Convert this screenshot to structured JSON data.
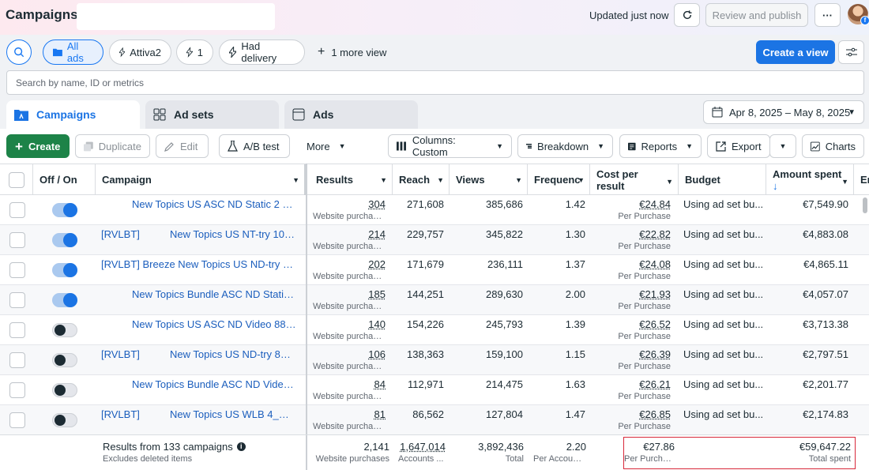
{
  "header": {
    "title": "Campaigns",
    "updated": "Updated just now",
    "review_publish": "Review and publish",
    "more": "···"
  },
  "views": {
    "all_ads": "All ads",
    "attiva2": "Attiva2",
    "one": "1",
    "had_delivery": "Had delivery",
    "more_view": "1 more view",
    "create_view": "Create a view"
  },
  "search": {
    "placeholder": "Search by name, ID or metrics"
  },
  "tabs": {
    "campaigns": "Campaigns",
    "ad_sets": "Ad sets",
    "ads": "Ads"
  },
  "date_range": "Apr 8, 2025 – May 8, 2025",
  "toolbar": {
    "create": "Create",
    "duplicate": "Duplicate",
    "edit": "Edit",
    "ab_test": "A/B test",
    "more": "More",
    "columns": "Columns: Custom",
    "breakdown": "Breakdown",
    "reports": "Reports",
    "export": "Export",
    "charts": "Charts"
  },
  "columns": {
    "off_on": "Off / On",
    "campaign": "Campaign",
    "results": "Results",
    "reach": "Reach",
    "views": "Views",
    "frequency": "Frequenc",
    "cost_per_result_1": "Cost per",
    "cost_per_result_2": "result",
    "budget": "Budget",
    "amount_spent": "Amount spent",
    "amount_spent_sort": "↓",
    "ends": "En"
  },
  "rows": [
    {
      "prefix": "",
      "name": "New Topics US ASC ND Static 2 65 8...",
      "on": true,
      "results": "304",
      "results_label": "Website purchases",
      "reach": "271,608",
      "views": "385,686",
      "frequency": "1.42",
      "cpr": "€24.84",
      "cpr_label": "Per Purchase",
      "budget": "Using ad set bu...",
      "spent": "€7,549.90"
    },
    {
      "prefix": "[RVLBT]",
      "name": "New Topics US NT-try 101_...",
      "on": true,
      "results": "214",
      "results_label": "Website purchases",
      "reach": "229,757",
      "views": "345,822",
      "frequency": "1.30",
      "cpr": "€22.82",
      "cpr_label": "Per Purchase",
      "budget": "Using ad set bu...",
      "spent": "€4,883.08"
    },
    {
      "prefix": "",
      "name": "[RVLBT] Breeze New Topics US ND-try 2_NY...",
      "on": true,
      "results": "202",
      "results_label": "Website purchases",
      "reach": "171,679",
      "views": "236,111",
      "frequency": "1.37",
      "cpr": "€24.08",
      "cpr_label": "Per Purchase",
      "budget": "Using ad set bu...",
      "spent": "€4,865.11"
    },
    {
      "prefix": "",
      "name": "New Topics Bundle ASC ND Static 2 ...",
      "on": true,
      "results": "185",
      "results_label": "Website purchases",
      "reach": "144,251",
      "views": "289,630",
      "frequency": "2.00",
      "cpr": "€21.93",
      "cpr_label": "Per Purchase",
      "budget": "Using ad set bu...",
      "spent": "€4,057.07"
    },
    {
      "prefix": "",
      "name": "New Topics US ASC ND Video 88 93 ...",
      "on": false,
      "results": "140",
      "results_label": "Website purchases",
      "reach": "154,226",
      "views": "245,793",
      "frequency": "1.39",
      "cpr": "€26.52",
      "cpr_label": "Per Purchase",
      "budget": "Using ad set bu...",
      "spent": "€3,713.38"
    },
    {
      "prefix": "[RVLBT]",
      "name": "New Topics US ND-try 82_[...",
      "on": false,
      "results": "106",
      "results_label": "Website purchases",
      "reach": "138,363",
      "views": "159,100",
      "frequency": "1.15",
      "cpr": "€26.39",
      "cpr_label": "Per Purchase",
      "budget": "Using ad set bu...",
      "spent": "€2,797.51"
    },
    {
      "prefix": "",
      "name": "New Topics Bundle ASC ND Video 88...",
      "on": false,
      "results": "84",
      "results_label": "Website purchases",
      "reach": "112,971",
      "views": "214,475",
      "frequency": "1.63",
      "cpr": "€26.21",
      "cpr_label": "Per Purchase",
      "budget": "Using ad set bu...",
      "spent": "€2,201.77"
    },
    {
      "prefix": "[RVLBT]",
      "name": "New Topics US WLB 4_NY_[...",
      "on": false,
      "results": "81",
      "results_label": "Website purchases",
      "reach": "86,562",
      "views": "127,804",
      "frequency": "1.47",
      "cpr": "€26.85",
      "cpr_label": "Per Purchase",
      "budget": "Using ad set bu...",
      "spent": "€2,174.83"
    }
  ],
  "totals": {
    "label": "Results from 133 campaigns",
    "sublabel": "Excludes deleted items",
    "results": "2,141",
    "results_label": "Website purchases",
    "reach": "1,647,014",
    "reach_label": "Accounts ...",
    "views": "3,892,436",
    "views_label": "Total",
    "frequency": "2.20",
    "frequency_label": "Per Account...",
    "cpr": "€27.86",
    "cpr_label": "Per Purchase",
    "spent": "€59,647.22",
    "spent_label": "Total spent"
  },
  "colors": {
    "accent": "#1b74e4",
    "create_green": "#1d8348",
    "highlight_red": "#d8293b"
  }
}
